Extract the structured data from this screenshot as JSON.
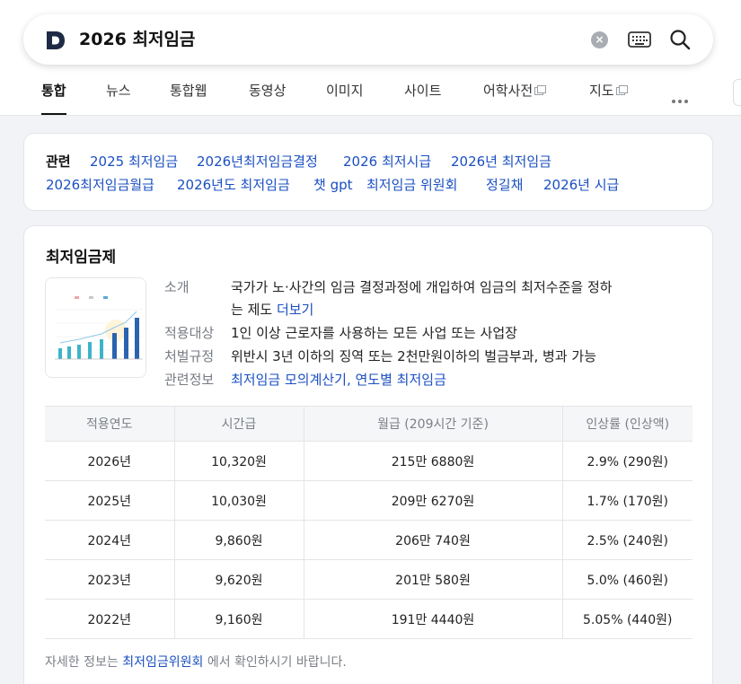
{
  "search": {
    "query": "2026 최저임금",
    "clear_icon": "clear-icon",
    "keyboard_icon": "keyboard-icon",
    "search_icon": "search-icon"
  },
  "tabs": [
    {
      "label": "통합",
      "active": true
    },
    {
      "label": "뉴스"
    },
    {
      "label": "통합웹"
    },
    {
      "label": "동영상"
    },
    {
      "label": "이미지"
    },
    {
      "label": "사이트"
    },
    {
      "label": "어학사전",
      "external": true
    },
    {
      "label": "지도",
      "external": true
    }
  ],
  "related": {
    "title": "관련",
    "items": [
      "2025 최저임금",
      "2026년최저임금결정",
      "2026 최저시급",
      "2026년 최저임금",
      "2026최저임금월급",
      "2026년도 최저임금",
      "챗 gpt",
      "최저임금 위원회",
      "정길채",
      "2026년 시급"
    ]
  },
  "info": {
    "title": "최저임금제",
    "intro_label": "소개",
    "intro_line1": "국가가 노·사간의 임금 결정과정에 개입하여 임금의 최저수준을 정하",
    "intro_line2": "는 제도",
    "more_link": "더보기",
    "target_label": "적용대상",
    "target_value": "1인 이상 근로자를 사용하는 모든 사업 또는 사업장",
    "penalty_label": "처벌규정",
    "penalty_value": "위반시 3년 이하의 징역 또는 2천만원이하의 벌금부과, 병과 가능",
    "related_label": "관련정보",
    "related_value": "최저임금 모의계산기, 연도별 최저임금"
  },
  "table": {
    "headers": [
      "적용연도",
      "시간급",
      "월급 (209시간 기준)",
      "인상률 (인상액)"
    ],
    "rows": [
      {
        "year": "2026년",
        "hourly": "10,320원",
        "monthly": "215만 6880원",
        "rate": "2.9% (290원)"
      },
      {
        "year": "2025년",
        "hourly": "10,030원",
        "monthly": "209만 6270원",
        "rate": "1.7% (170원)"
      },
      {
        "year": "2024년",
        "hourly": "9,860원",
        "monthly": "206만 740원",
        "rate": "2.5% (240원)"
      },
      {
        "year": "2023년",
        "hourly": "9,620원",
        "monthly": "201만 580원",
        "rate": "5.0% (460원)"
      },
      {
        "year": "2022년",
        "hourly": "9,160원",
        "monthly": "191만 4440원",
        "rate": "5.05% (440원)"
      }
    ]
  },
  "footer": {
    "prefix": "자세한 정보는",
    "link": "최저임금위원회",
    "suffix": "에서 확인하시기 바랍니다."
  },
  "colors": {
    "link": "#1a4fc1",
    "brand": "#1f2a44"
  }
}
